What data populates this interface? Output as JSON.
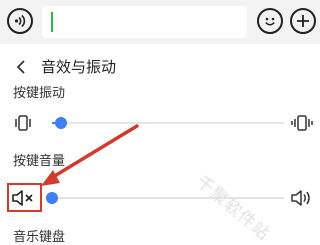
{
  "header": {
    "title": "音效与振动"
  },
  "sections": {
    "vibration_label": "按键振动",
    "volume_label": "按键音量",
    "keyboard_label": "音乐键盘"
  },
  "sliders": {
    "vibration_level": 0.04,
    "volume_level": 0.0
  },
  "watermark": "千聚软件站",
  "colors": {
    "accent": "#3f7ef7",
    "caret": "#1fbe4b",
    "annotation": "#d23a2e"
  },
  "icons": {
    "top_left": "voice-input-icon",
    "top_right_1": "emoji-icon",
    "top_right_2": "add-icon",
    "back": "chevron-left-icon",
    "vibration": "phone-vibrate-icon",
    "volume": "speaker-mute-icon"
  }
}
